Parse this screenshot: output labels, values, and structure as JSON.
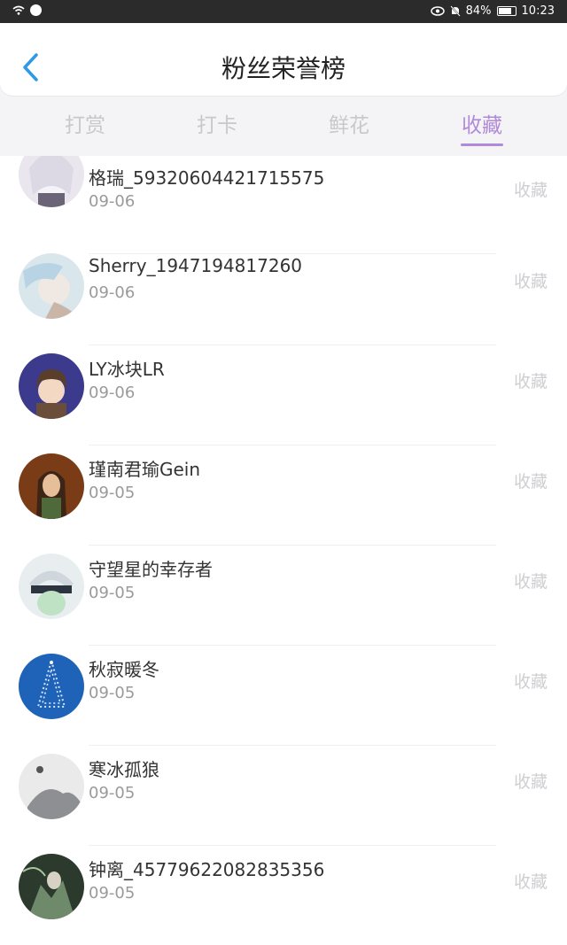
{
  "status": {
    "battery": "84%",
    "time": "10:23"
  },
  "header": {
    "title": "粉丝荣誉榜"
  },
  "tabs": [
    {
      "label": "打赏"
    },
    {
      "label": "打卡"
    },
    {
      "label": "鲜花"
    },
    {
      "label": "收藏"
    }
  ],
  "active_tab": "收藏",
  "colors": {
    "accent": "#b08ad8",
    "back": "#2e9ae6"
  },
  "items": [
    {
      "name": "格瑞_59320604421715575",
      "date": "09-06",
      "action": "收藏"
    },
    {
      "name": "Sherry_1947194817260",
      "date": "09-06",
      "action": "收藏"
    },
    {
      "name": "LY冰块LR",
      "date": "09-06",
      "action": "收藏"
    },
    {
      "name": "瑾南君瑜Gein",
      "date": "09-05",
      "action": "收藏"
    },
    {
      "name": "守望星的幸存者",
      "date": "09-05",
      "action": "收藏"
    },
    {
      "name": "秋寂暖冬",
      "date": "09-05",
      "action": "收藏"
    },
    {
      "name": "寒冰孤狼",
      "date": "09-05",
      "action": "收藏"
    },
    {
      "name": "钟离_45779622082835356",
      "date": "09-05",
      "action": "收藏"
    }
  ]
}
